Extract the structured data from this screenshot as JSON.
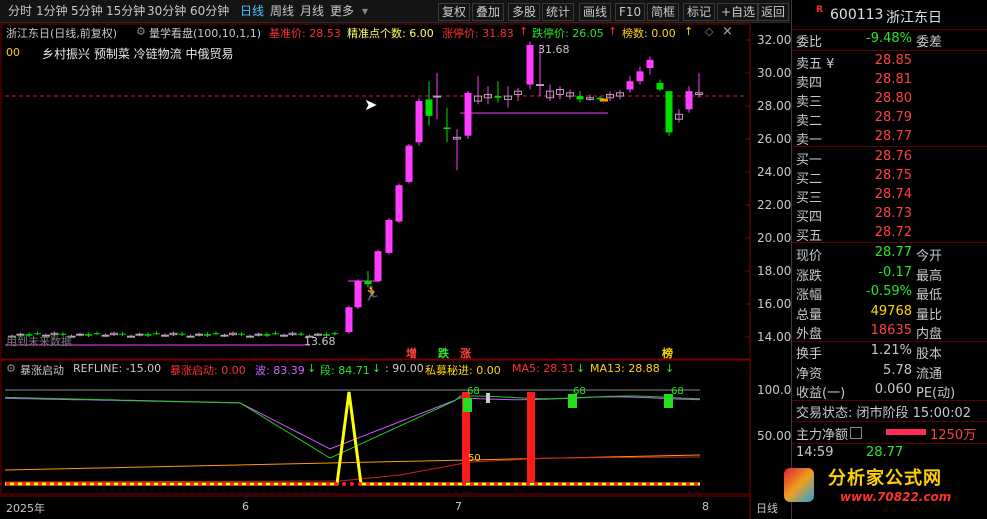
{
  "toolbar": {
    "items": [
      "分时",
      "1分钟",
      "5分钟",
      "15分钟",
      "30分钟",
      "60分钟",
      "日线",
      "周线",
      "月线",
      "更多"
    ],
    "active": "日线",
    "right_items": [
      "复权",
      "叠加",
      "多股",
      "统计",
      "画线",
      "F10",
      "简框",
      "标记",
      "+自选",
      "返回"
    ]
  },
  "chart": {
    "title": "浙江东日(日线,前复权)",
    "indicator_name": "量学看盘(100,10,1,1)",
    "base_price_label": "基准价: 28.53",
    "ref_count_label": "精准点个数: 6.00",
    "limit_up_label": "涨停价: 31.83",
    "limit_down_label": "跌停价: 26.05",
    "leader_label": "榜数: 0.00",
    "prefix_00": "00",
    "tags": "乡村振兴 预制菜 冷链物流 中俄贸易",
    "high_label": "31.68",
    "low_label": "13.68",
    "future_label": "用到未来数据",
    "marks": [
      "增",
      "跌",
      "涨",
      "榜"
    ],
    "y_ticks": [
      "32.00",
      "30.00",
      "28.00",
      "26.00",
      "24.00",
      "22.00",
      "20.00",
      "18.00",
      "16.00",
      "14.00"
    ],
    "x_labels": [
      "2025年",
      "6",
      "7",
      "8"
    ],
    "x_mode": "日线"
  },
  "indicator2": {
    "name": "暴涨启动",
    "refline": "REFLINE: -15.00",
    "startup": "暴涨启动: 0.00",
    "wave": "波: 83.39",
    "seg": "段: 84.71",
    "ninety": ": 90.00",
    "private": "私募秘进: 0.00",
    "ma5": "MA5: 28.31",
    "ma13": "MA13: 28.88",
    "y_ticks": [
      "100.0",
      "50.00"
    ],
    "box_labels": [
      "68",
      "68",
      "68"
    ],
    "mid_label": "50"
  },
  "quote": {
    "code": "600113",
    "name": "浙江东日",
    "weibi_label": "委比",
    "weibi": "-9.48%",
    "weicha_label": "委差",
    "asks": [
      {
        "label": "卖五 ¥",
        "price": "28.85"
      },
      {
        "label": "卖四",
        "price": "28.81"
      },
      {
        "label": "卖三",
        "price": "28.80"
      },
      {
        "label": "卖二",
        "price": "28.79"
      },
      {
        "label": "卖一",
        "price": "28.77"
      }
    ],
    "bids": [
      {
        "label": "买一",
        "price": "28.76"
      },
      {
        "label": "买二",
        "price": "28.75"
      },
      {
        "label": "买三",
        "price": "28.74"
      },
      {
        "label": "买四",
        "price": "28.73"
      },
      {
        "label": "买五",
        "price": "28.72"
      }
    ],
    "stats": [
      {
        "l1": "现价",
        "v1": "28.77",
        "c1": "dn",
        "l2": "今开"
      },
      {
        "l1": "涨跌",
        "v1": "-0.17",
        "c1": "dn",
        "l2": "最高"
      },
      {
        "l1": "涨幅",
        "v1": "-0.59%",
        "c1": "dn",
        "l2": "最低"
      },
      {
        "l1": "总量",
        "v1": "49768",
        "c1": "yl",
        "l2": "量比"
      },
      {
        "l1": "外盘",
        "v1": "18635",
        "c1": "up",
        "l2": "内盘"
      }
    ],
    "stats2": [
      {
        "l1": "换手",
        "v1": "1.21%",
        "l2": "股本"
      },
      {
        "l1": "净资",
        "v1": "5.78",
        "l2": "流通"
      },
      {
        "l1": "收益(一)",
        "v1": "0.060",
        "l2": "PE(动)"
      }
    ],
    "trade_status": "交易状态: 闭市阶段 15:00:02",
    "main_flow_label": "主力净额",
    "main_flow_value": "1250万",
    "last_time": "14:59",
    "last_price": "28.77",
    "watermark_main": "分析家公式网",
    "watermark_url": "www.70822.com"
  },
  "colors": {
    "up": "#ff3cff",
    "down": "#00dd00",
    "bg": "#000000"
  }
}
